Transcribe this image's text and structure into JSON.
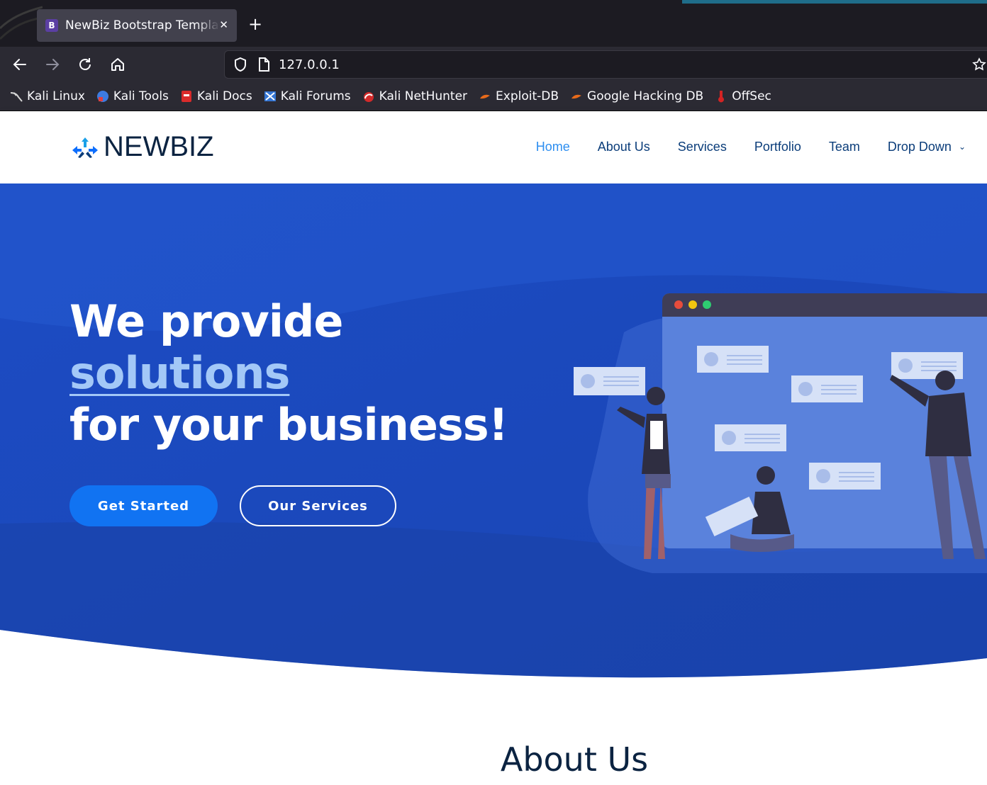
{
  "browser": {
    "tab_title": "NewBiz Bootstrap Template",
    "tab_favicon": "B",
    "url": "127.0.0.1",
    "bookmarks": [
      {
        "label": "Kali Linux",
        "icon": "kali-dragon-icon"
      },
      {
        "label": "Kali Tools",
        "icon": "kali-tools-icon"
      },
      {
        "label": "Kali Docs",
        "icon": "kali-docs-icon"
      },
      {
        "label": "Kali Forums",
        "icon": "kali-forums-icon"
      },
      {
        "label": "Kali NetHunter",
        "icon": "nethunter-icon"
      },
      {
        "label": "Exploit-DB",
        "icon": "exploit-db-icon"
      },
      {
        "label": "Google Hacking DB",
        "icon": "ghdb-icon"
      },
      {
        "label": "OffSec",
        "icon": "offsec-icon"
      }
    ]
  },
  "site": {
    "logo_text": "NEWBIZ",
    "nav": [
      {
        "label": "Home",
        "active": true
      },
      {
        "label": "About Us"
      },
      {
        "label": "Services"
      },
      {
        "label": "Portfolio"
      },
      {
        "label": "Team"
      },
      {
        "label": "Drop Down",
        "dropdown": true
      }
    ]
  },
  "hero": {
    "line1": "We provide",
    "line2": "solutions",
    "line3": "for your business!",
    "primary_button": "Get Started",
    "secondary_button": "Our Services"
  },
  "about": {
    "title": "About Us"
  },
  "colors": {
    "hero_blue": "#1d4fc0",
    "nav_active": "#2d8ef0",
    "nav_text": "#0b3d7a",
    "button_primary": "#1173f2"
  }
}
